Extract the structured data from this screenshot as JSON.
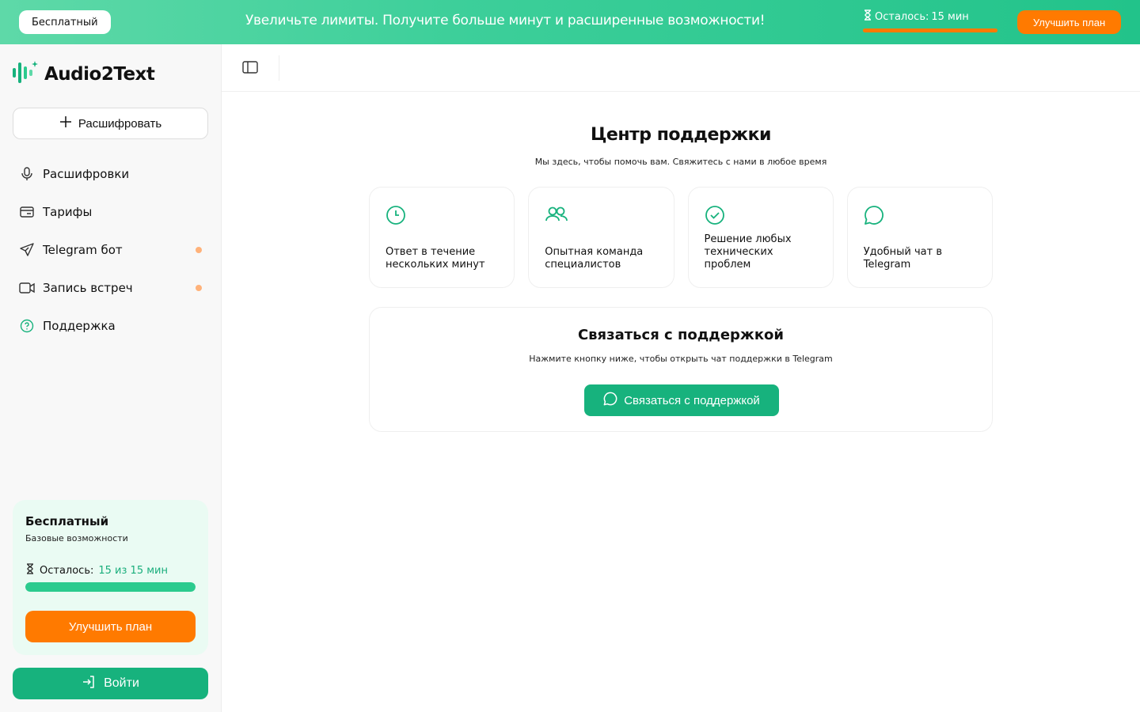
{
  "banner": {
    "plan_label": "Бесплатный",
    "message": "Увеличьте лимиты. Получите больше минут и расширенные возможности!",
    "remaining_label": "Осталось:",
    "remaining_value": "15 мин",
    "remaining_fraction": 1.0,
    "upgrade_label": "Улучшить план"
  },
  "sidebar": {
    "app_name": "Audio2Text",
    "new_button": "Расшифровать",
    "items": [
      {
        "label": "Расшифровки",
        "icon": "microphone-icon",
        "dot": false
      },
      {
        "label": "Тарифы",
        "icon": "card-icon",
        "dot": false
      },
      {
        "label": "Telegram бот",
        "icon": "send-icon",
        "dot": true
      },
      {
        "label": "Запись встреч",
        "icon": "video-icon",
        "dot": true
      },
      {
        "label": "Поддержка",
        "icon": "help-circle-icon",
        "dot": false
      }
    ],
    "plan_card": {
      "title": "Бесплатный",
      "subtitle": "Базовые возможности",
      "remaining_label": "Осталось:",
      "remaining_value": "15 из 15 мин",
      "progress_fraction": 1.0,
      "upgrade_label": "Улучшить план"
    },
    "login_label": "Войти"
  },
  "main": {
    "title": "Центр поддержки",
    "subtitle": "Мы здесь, чтобы помочь вам. Свяжитесь с нами в любое время",
    "features": [
      {
        "text": "Ответ в течение нескольких минут",
        "icon": "clock-icon"
      },
      {
        "text": "Опытная команда специалистов",
        "icon": "users-icon"
      },
      {
        "text": "Решение любых технических проблем",
        "icon": "check-circle-icon"
      },
      {
        "text": "Удобный чат в Telegram",
        "icon": "chat-bubble-icon"
      }
    ],
    "contact": {
      "title": "Связаться с поддержкой",
      "subtitle": "Нажмите кнопку ниже, чтобы открыть чат поддержки в Telegram",
      "button_label": "Связаться с поддержкой"
    }
  },
  "colors": {
    "accent_green": "#17b27d",
    "accent_orange": "#ff7a00",
    "banner_gradient_start": "#5ed9a8",
    "banner_gradient_end": "#22c38a",
    "dot_color": "#ffb27a"
  }
}
